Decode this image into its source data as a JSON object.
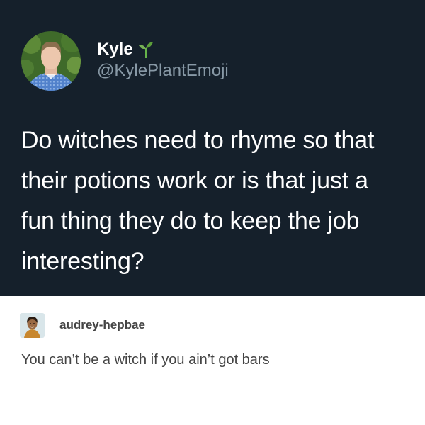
{
  "tweet": {
    "author_name": "Kyle",
    "author_handle": "@KylePlantEmoji",
    "name_emoji_icon": "seedling-icon",
    "text": "Do witches need to rhyme so that their potions work or is that just a fun thing they do to keep the job interesting?",
    "colors": {
      "background": "#15202b",
      "text": "#ffffff",
      "handle": "#8899a6"
    }
  },
  "reply": {
    "username": "audrey-hepbae",
    "text": "You can’t be a witch if you ain’t got bars",
    "colors": {
      "background": "#ffffff",
      "text": "#444444"
    }
  }
}
